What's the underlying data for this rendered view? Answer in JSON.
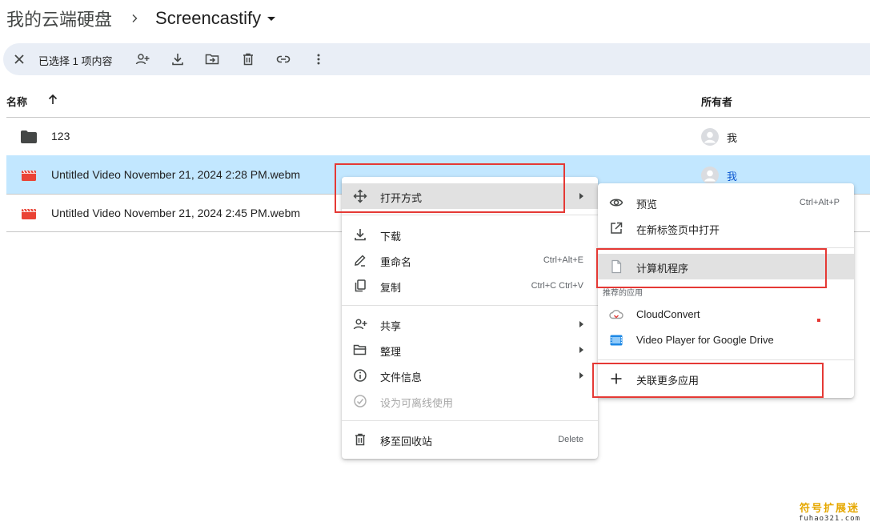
{
  "breadcrumb": {
    "root": "我的云端硬盘",
    "current": "Screencastify"
  },
  "selection_bar": {
    "label": "已选择 1 项内容",
    "actions": [
      "close-icon",
      "share-icon",
      "download-icon",
      "move-icon",
      "trash-icon",
      "link-icon",
      "more-vert-icon"
    ]
  },
  "columns": {
    "name": "名称",
    "owner": "所有者"
  },
  "files": [
    {
      "name": "123",
      "type": "folder",
      "owner": "我",
      "selected": false
    },
    {
      "name": "Untitled Video November 21, 2024 2:28 PM.webm",
      "type": "video",
      "owner": "我",
      "selected": true
    },
    {
      "name": "Untitled Video November 21, 2024 2:45 PM.webm",
      "type": "video",
      "owner": "",
      "selected": false
    }
  ],
  "context_menu": {
    "open_with": "打开方式",
    "download": "下载",
    "rename": "重命名",
    "rename_shortcut": "Ctrl+Alt+E",
    "copy": "复制",
    "copy_shortcut": "Ctrl+C Ctrl+V",
    "share": "共享",
    "organize": "整理",
    "file_info": "文件信息",
    "offline": "设为可离线使用",
    "trash": "移至回收站",
    "trash_shortcut": "Delete"
  },
  "submenu": {
    "preview": "预览",
    "preview_shortcut": "Ctrl+Alt+P",
    "open_new_tab": "在新标签页中打开",
    "computer_app": "计算机程序",
    "suggested_section": "推荐的应用",
    "cloudconvert": "CloudConvert",
    "video_player": "Video Player for Google Drive",
    "connect_more": "关联更多应用"
  },
  "watermark": {
    "main": "符号扩展迷",
    "sub": "fuhao321.com"
  },
  "colors": {
    "selected_row": "#c2e7ff",
    "selection_bar": "#e9eef6",
    "accent_blue": "#0b57d0",
    "annotation_red": "#e53935",
    "video_red": "#ea4335"
  }
}
